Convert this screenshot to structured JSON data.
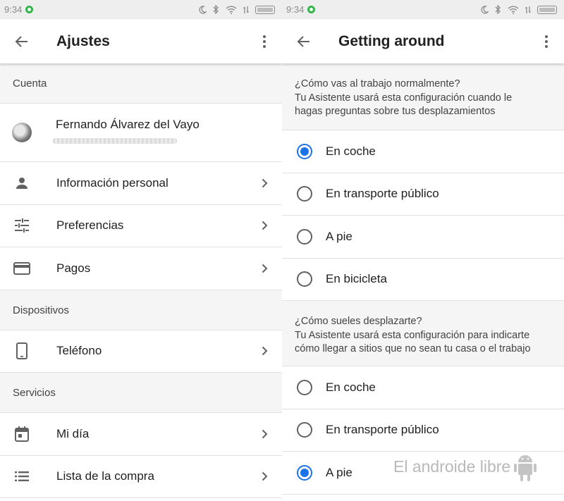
{
  "left": {
    "status": {
      "time": "9:34"
    },
    "title": "Ajustes",
    "sections": {
      "cuenta": "Cuenta",
      "dispositivos": "Dispositivos",
      "servicios": "Servicios"
    },
    "account": {
      "name": "Fernando Álvarez del Vayo"
    },
    "rows": {
      "info": "Información personal",
      "prefs": "Preferencias",
      "pagos": "Pagos",
      "telefono": "Teléfono",
      "midia": "Mi día",
      "compra": "Lista de la compra"
    }
  },
  "right": {
    "status": {
      "time": "9:34"
    },
    "title": "Getting around",
    "q1": {
      "line1": "¿Cómo vas al trabajo normalmente?",
      "line2": "Tu Asistente usará esta configuración cuando le",
      "line3": "hagas preguntas sobre tus desplazamientos",
      "options": [
        "En coche",
        "En transporte público",
        "A pie",
        "En bicicleta"
      ],
      "selected": "En coche"
    },
    "q2": {
      "line1": "¿Cómo sueles desplazarte?",
      "line2": "Tu Asistente usará esta configuración para indicarte",
      "line3": "cómo llegar a sitios que no sean tu casa o el trabajo",
      "options": [
        "En coche",
        "En transporte público",
        "A pie"
      ],
      "selected": "A pie"
    }
  },
  "watermark": "El androide libre",
  "colors": {
    "accent": "#1a73e8",
    "whatsapp": "#34b44a"
  }
}
